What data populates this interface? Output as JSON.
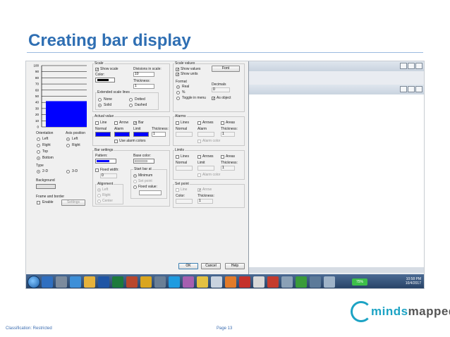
{
  "slide": {
    "title": "Creating bar display",
    "classification": "Classification: Restricted",
    "page": "Page 13",
    "logo": "mindsmapped"
  },
  "preview": {
    "scale_labels": [
      "100",
      "90",
      "80",
      "70",
      "60",
      "50",
      "40",
      "30",
      "20",
      "10",
      "0"
    ],
    "bar_value_percent": 42,
    "bar_color": "#0000ff",
    "orientation_label": "Orientation",
    "orientation_options": [
      "Left",
      "Right",
      "Top",
      "Bottom"
    ],
    "orientation_selected": "Bottom",
    "axis_position_label": "Axis position",
    "axis_options": [
      "Left",
      "Right"
    ],
    "axis_selected": "Left",
    "type_label": "Type",
    "type_options": [
      "2-D",
      "3-D"
    ],
    "type_selected": "2-D",
    "background_label": "Background",
    "frame_label": "Frame and border",
    "frame_enable": "Enable",
    "frame_settings_btn": "Settings"
  },
  "scale": {
    "group": "Scale",
    "show_scale": "Show scale",
    "divisions_label": "Divisions in scale:",
    "divisions_value": "10",
    "color_label": "Color:",
    "thickness_label": "Thickness:",
    "thickness_value": "1",
    "extended_label": "Extended scale lines",
    "ext_options": [
      "None",
      "Solid",
      "Dotted",
      "Dashed"
    ]
  },
  "scale_values": {
    "group": "Scale values",
    "show_values": "Show values",
    "show_units": "Show units",
    "font_btn": "Font",
    "format_label": "Format",
    "decimals_label": "Decimals",
    "decimals_value": "0",
    "format_options": [
      "Real",
      "%",
      "Toggle in menu"
    ],
    "as_object": "As object"
  },
  "actual_value": {
    "group": "Actual value",
    "line": "Line",
    "arrow": "Arrow",
    "bar": "Bar",
    "normal": "Normal",
    "alarm": "Alarm",
    "limit": "Limit",
    "thickness": "Thickness:",
    "thickness_value": "1",
    "use_alarm_colors": "Use alarm colors"
  },
  "alarms": {
    "group": "Alarms",
    "lines": "Lines",
    "arrows": "Arrows",
    "areas": "Areas",
    "normal": "Normal",
    "alarm": "Alarm",
    "thickness": "Thickness:",
    "thickness_value": "1",
    "alarm_color": "Alarm color"
  },
  "bar_settings": {
    "group": "Bar settings",
    "pattern": "Pattern:",
    "base_color": "Base color:",
    "fixed_width": "Fixed width:",
    "fixed_width_value": "0",
    "start_bar_at": "Start bar at",
    "start_options": [
      "Minimum",
      "Set point",
      "Fixed value:"
    ],
    "alignment": "Alignment",
    "align_options": [
      "Left",
      "Right",
      "Center"
    ]
  },
  "limits": {
    "group": "Limits",
    "lines": "Lines",
    "arrows": "Arrows",
    "areas": "Areas",
    "normal": "Normal",
    "limit": "Limit",
    "thickness": "Thickness:",
    "thickness_value": "1",
    "alarm_color": "Alarm color"
  },
  "set_point": {
    "group": "Set point",
    "line": "Line",
    "arrow": "Arrow",
    "color": "Color:",
    "thickness": "Thickness:",
    "thickness_value": "1"
  },
  "buttons": {
    "ok": "OK",
    "cancel": "Cancel",
    "help": "Help"
  },
  "taskbar": {
    "battery": "75%",
    "time": "10:58 PM",
    "date": "10/4/2017"
  }
}
